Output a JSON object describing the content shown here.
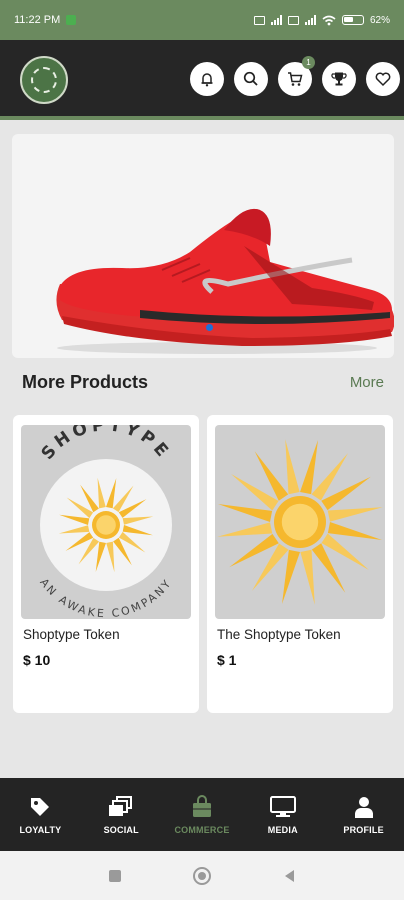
{
  "status_bar": {
    "time": "11:22 PM",
    "battery": "62%"
  },
  "header": {
    "logo_icon": "leaf-seal-logo",
    "actions": [
      {
        "name": "notifications",
        "icon": "bell-icon"
      },
      {
        "name": "search",
        "icon": "search-icon"
      },
      {
        "name": "cart",
        "icon": "cart-icon",
        "badge": "1"
      },
      {
        "name": "rewards",
        "icon": "trophy-icon"
      },
      {
        "name": "wishlist",
        "icon": "heart-icon"
      }
    ]
  },
  "hero": {
    "image": "red running shoe",
    "slide_count": 1,
    "active_slide": 1
  },
  "products_section": {
    "title": "More Products",
    "more_label": "More",
    "items": [
      {
        "name": "Shoptype Token",
        "price": "$ 10",
        "image_text_top": "SHOPTYPE",
        "image_text_bottom": "AN AWAKE COMPANY"
      },
      {
        "name": "The Shoptype Token",
        "price": "$ 1"
      }
    ]
  },
  "bottom_nav": {
    "items": [
      {
        "label": "LOYALTY",
        "icon": "tag-icon",
        "active": false
      },
      {
        "label": "SOCIAL",
        "icon": "cards-icon",
        "active": false
      },
      {
        "label": "COMMERCE",
        "icon": "shopping-bag-icon",
        "active": true
      },
      {
        "label": "MEDIA",
        "icon": "monitor-icon",
        "active": false
      },
      {
        "label": "PROFILE",
        "icon": "person-icon",
        "active": false
      }
    ]
  },
  "colors": {
    "brand": "#6b8a5f",
    "dark": "#262626",
    "accent_blue": "#1f6fd6",
    "sun": "#f5b82e"
  }
}
